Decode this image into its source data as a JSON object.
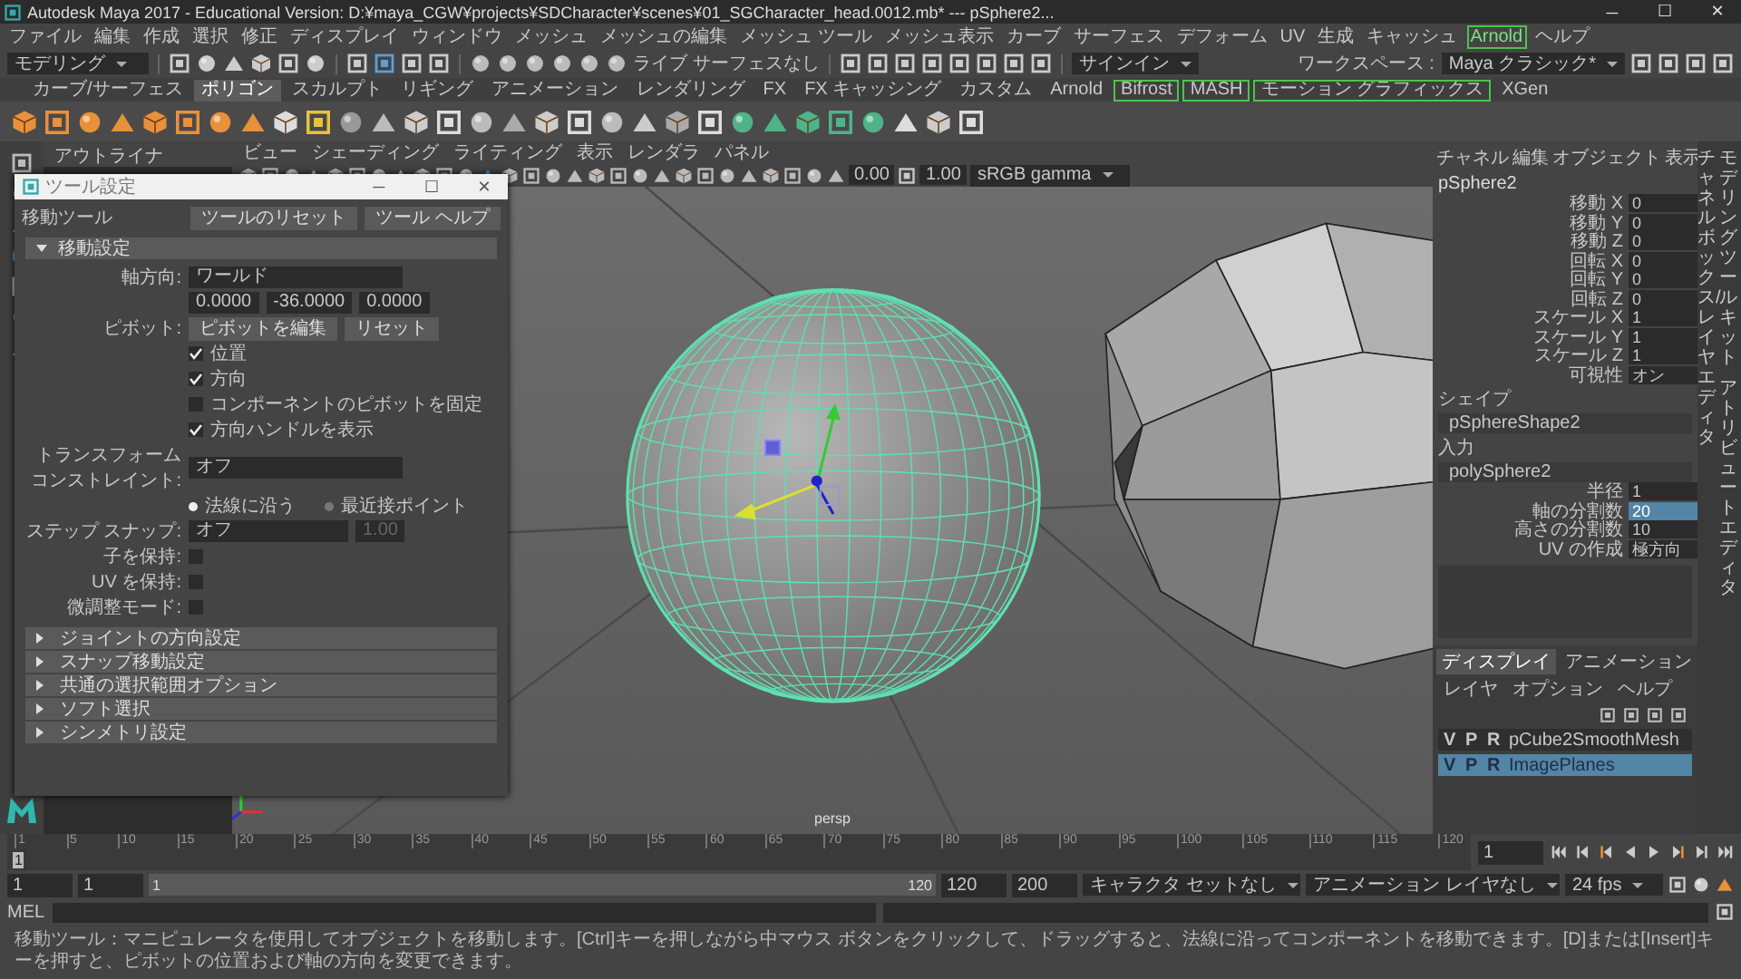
{
  "window": {
    "title": "Autodesk Maya 2017 - Educational Version: D:¥maya_CGW¥projects¥SDCharacter¥scenes¥01_SGCharacter_head.0012.mb*  ---  pSphere2...",
    "controls": [
      "─",
      "☐",
      "✕"
    ]
  },
  "menu": [
    {
      "label": "ファイル",
      "boxed": false
    },
    {
      "label": "編集",
      "boxed": false
    },
    {
      "label": "作成",
      "boxed": false
    },
    {
      "label": "選択",
      "boxed": false
    },
    {
      "label": "修正",
      "boxed": false
    },
    {
      "label": "ディスプレイ",
      "boxed": false
    },
    {
      "label": "ウィンドウ",
      "boxed": false
    },
    {
      "label": "メッシュ",
      "boxed": false
    },
    {
      "label": "メッシュの編集",
      "boxed": false
    },
    {
      "label": "メッシュ ツール",
      "boxed": false
    },
    {
      "label": "メッシュ表示",
      "boxed": false
    },
    {
      "label": "カーブ",
      "boxed": false
    },
    {
      "label": "サーフェス",
      "boxed": false
    },
    {
      "label": "デフォーム",
      "boxed": false
    },
    {
      "label": "UV",
      "boxed": false
    },
    {
      "label": "生成",
      "boxed": false
    },
    {
      "label": "キャッシュ",
      "boxed": false
    },
    {
      "label": "Arnold",
      "boxed": true
    },
    {
      "label": "ヘルプ",
      "boxed": false
    }
  ],
  "workspace": {
    "label": "ワークスペース :",
    "value": "Maya クラシック*"
  },
  "status_line": {
    "mode": "モデリング",
    "live_surface": "ライブ サーフェスなし",
    "sign_in": "サインイン"
  },
  "shelf_tabs": [
    {
      "label": "カーブ/サーフェス",
      "selected": false,
      "boxed": false
    },
    {
      "label": "ポリゴン",
      "selected": true,
      "boxed": false
    },
    {
      "label": "スカルプト",
      "selected": false,
      "boxed": false
    },
    {
      "label": "リギング",
      "selected": false,
      "boxed": false
    },
    {
      "label": "アニメーション",
      "selected": false,
      "boxed": false
    },
    {
      "label": "レンダリング",
      "selected": false,
      "boxed": false
    },
    {
      "label": "FX",
      "selected": false,
      "boxed": false
    },
    {
      "label": "FX キャッシング",
      "selected": false,
      "boxed": false
    },
    {
      "label": "カスタム",
      "selected": false,
      "boxed": false
    },
    {
      "label": "Arnold",
      "selected": false,
      "boxed": false
    },
    {
      "label": "Bifrost",
      "selected": false,
      "boxed": true
    },
    {
      "label": "MASH",
      "selected": false,
      "boxed": true
    },
    {
      "label": "モーション グラフィックス",
      "selected": false,
      "boxed": true
    },
    {
      "label": "XGen",
      "selected": false,
      "boxed": false
    }
  ],
  "outliner": {
    "tab": "アウトライナ"
  },
  "viewport": {
    "menu": [
      "ビュー",
      "シェーディング",
      "ライティング",
      "表示",
      "レンダラ",
      "パネル"
    ],
    "exposure": "0.00",
    "gamma": "1.00",
    "color_space": "sRGB gamma",
    "camera": "persp"
  },
  "tool_settings": {
    "title": "ツール設定",
    "tool_name": "移動ツール",
    "buttons": [
      "ツールのリセット",
      "ツール ヘルプ"
    ],
    "sections": [
      {
        "label": "移動設定",
        "expanded": true
      },
      {
        "label": "ジョイントの方向設定",
        "expanded": false
      },
      {
        "label": "スナップ移動設定",
        "expanded": false
      },
      {
        "label": "共通の選択範囲オプション",
        "expanded": false
      },
      {
        "label": "ソフト選択",
        "expanded": false
      },
      {
        "label": "シンメトリ設定",
        "expanded": false
      }
    ],
    "axis": {
      "label": "軸方向:",
      "value": "ワールド"
    },
    "axis_values": [
      "0.0000",
      "-36.0000",
      "0.0000"
    ],
    "pivot": {
      "label": "ピボット:",
      "buttons": [
        "ピボットを編集",
        "リセット"
      ]
    },
    "pivot_options": [
      {
        "label": "位置",
        "checked": true
      },
      {
        "label": "方向",
        "checked": true
      },
      {
        "label": "コンポーネントのピボットを固定",
        "checked": false
      },
      {
        "label": "方向ハンドルを表示",
        "checked": true
      }
    ],
    "constraint": {
      "label": "トランスフォームコンストレイント:",
      "value": "オフ"
    },
    "constraint_modes": [
      {
        "label": "法線に沿う",
        "selected": true
      },
      {
        "label": "最近接ポイント",
        "selected": false
      }
    ],
    "step_snap": {
      "label": "ステップ スナップ:",
      "value": "オフ",
      "amount": "1.00"
    },
    "keep_options": [
      {
        "label": "子を保持:",
        "checked": false
      },
      {
        "label": "UV を保持:",
        "checked": false
      },
      {
        "label": "微調整モード:",
        "checked": false
      }
    ]
  },
  "channel_box": {
    "menu": [
      "チャネル",
      "編集",
      "オブジェクト",
      "表示"
    ],
    "object": "pSphere2",
    "channels": [
      {
        "name": "移動 X",
        "value": "0",
        "selected": false
      },
      {
        "name": "移動 Y",
        "value": "0",
        "selected": false
      },
      {
        "name": "移動 Z",
        "value": "0",
        "selected": false
      },
      {
        "name": "回転 X",
        "value": "0",
        "selected": false
      },
      {
        "name": "回転 Y",
        "value": "0",
        "selected": false
      },
      {
        "name": "回転 Z",
        "value": "0",
        "selected": false
      },
      {
        "name": "スケール X",
        "value": "1",
        "selected": false
      },
      {
        "name": "スケール Y",
        "value": "1",
        "selected": false
      },
      {
        "name": "スケール Z",
        "value": "1",
        "selected": false
      },
      {
        "name": "可視性",
        "value": "オン",
        "selected": false
      }
    ],
    "shapes_label": "シェイプ",
    "shape": "pSphereShape2",
    "inputs_label": "入力",
    "input": "polySphere2",
    "input_channels": [
      {
        "name": "半径",
        "value": "1",
        "selected": false
      },
      {
        "name": "軸の分割数",
        "value": "20",
        "selected": true
      },
      {
        "name": "高さの分割数",
        "value": "10",
        "selected": false
      },
      {
        "name": "UV の作成",
        "value": "極方向",
        "selected": false
      }
    ]
  },
  "side_tabs": [
    "チャネルボックス/レイヤエディタ",
    "モデリングツールキット",
    "アトリビュートエディタ"
  ],
  "layer_editor": {
    "tabs": [
      {
        "label": "ディスプレイ",
        "selected": true
      },
      {
        "label": "アニメーション",
        "selected": false
      }
    ],
    "menu": [
      "レイヤ",
      "オプション",
      "ヘルプ"
    ],
    "layers": [
      {
        "v": "V",
        "p": "P",
        "r": "R",
        "name": "pCube2SmoothMesh",
        "selected": false
      },
      {
        "v": "V",
        "p": "P",
        "r": "R",
        "name": "ImagePlanes",
        "selected": true
      }
    ]
  },
  "timeline": {
    "ticks": [
      "1",
      "5",
      "10",
      "15",
      "20",
      "25",
      "30",
      "35",
      "40",
      "45",
      "50",
      "55",
      "60",
      "65",
      "70",
      "75",
      "80",
      "85",
      "90",
      "95",
      "100",
      "105",
      "110",
      "115",
      "120"
    ],
    "current": "1",
    "level": 0,
    "current_field": "1"
  },
  "range": {
    "start": "1",
    "playback_start": "1",
    "slider_start": "1",
    "slider_end": "120",
    "level": 1,
    "playback_end": "120",
    "end": "200",
    "character_set": "キャラクタ セットなし",
    "anim_layer": "アニメーション レイヤなし",
    "fps": "24 fps"
  },
  "command_line": {
    "label": "MEL"
  },
  "help_line": "移動ツール：マニピュレータを使用してオブジェクトを移動します。[Ctrl]キーを押しながら中マウス ボタンをクリックして、ドラッグすると、法線に沿ってコンポーネントを移動できます。[D]または[Insert]キーを押すと、ピボットの位置および軸の方向を変更できます。"
}
